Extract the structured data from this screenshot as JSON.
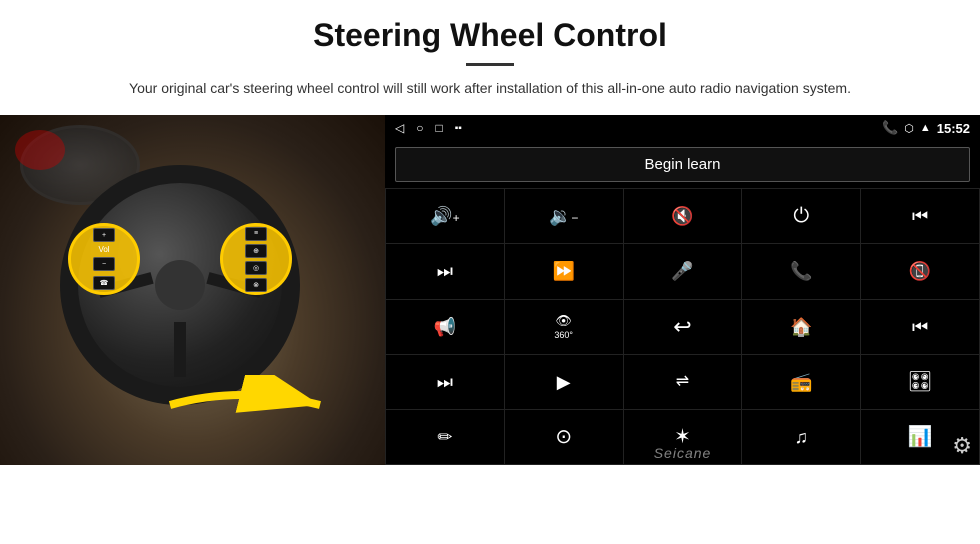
{
  "header": {
    "title": "Steering Wheel Control",
    "subtitle": "Your original car's steering wheel control will still work after installation of this all-in-one auto radio navigation system."
  },
  "status_bar": {
    "time": "15:52",
    "icons": [
      "back-arrow",
      "home-circle",
      "square-icon",
      "signal-icon",
      "phone-icon",
      "location-icon",
      "wifi-icon"
    ]
  },
  "begin_learn": {
    "label": "Begin learn"
  },
  "grid": {
    "cells": [
      {
        "icon": "🔊+",
        "label": "vol-up"
      },
      {
        "icon": "🔊−",
        "label": "vol-down"
      },
      {
        "icon": "🔇",
        "label": "mute"
      },
      {
        "icon": "⏻",
        "label": "power"
      },
      {
        "icon": "⏮",
        "label": "prev"
      },
      {
        "icon": "⏭",
        "label": "next"
      },
      {
        "icon": "⏩",
        "label": "fast-forward"
      },
      {
        "icon": "🎤",
        "label": "mic"
      },
      {
        "icon": "📞",
        "label": "call"
      },
      {
        "icon": "📵",
        "label": "end-call"
      },
      {
        "icon": "📢",
        "label": "horn"
      },
      {
        "icon": "👁360",
        "label": "360-view"
      },
      {
        "icon": "↩",
        "label": "back"
      },
      {
        "icon": "🏠",
        "label": "home"
      },
      {
        "icon": "⏮⏮",
        "label": "skip-back"
      },
      {
        "icon": "⏭⏭",
        "label": "skip-fwd"
      },
      {
        "icon": "▶",
        "label": "nav"
      },
      {
        "icon": "⇌",
        "label": "eq"
      },
      {
        "icon": "📻",
        "label": "radio"
      },
      {
        "icon": "🎛",
        "label": "settings"
      },
      {
        "icon": "✏",
        "label": "edit"
      },
      {
        "icon": "⊙",
        "label": "360-btn"
      },
      {
        "icon": "✶",
        "label": "bluetooth"
      },
      {
        "icon": "♫",
        "label": "music"
      },
      {
        "icon": "📊",
        "label": "equalizer"
      }
    ]
  },
  "watermark": "Seicane"
}
